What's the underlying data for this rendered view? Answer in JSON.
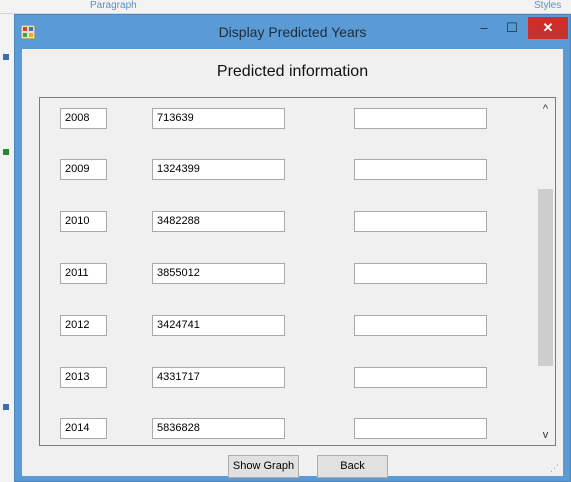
{
  "background": {
    "ribbon_tabs": [
      "Paragraph",
      "Styles"
    ]
  },
  "window": {
    "title": "Display Predicted Years",
    "controls": {
      "minimize": "–",
      "maximize": "☐",
      "close": "✕"
    },
    "heading": "Predicted information"
  },
  "rows": [
    {
      "year": "2008",
      "value": "713639",
      "extra": ""
    },
    {
      "year": "2009",
      "value": "1324399",
      "extra": ""
    },
    {
      "year": "2010",
      "value": "3482288",
      "extra": ""
    },
    {
      "year": "2011",
      "value": "3855012",
      "extra": ""
    },
    {
      "year": "2012",
      "value": "3424741",
      "extra": ""
    },
    {
      "year": "2013",
      "value": "4331717",
      "extra": ""
    },
    {
      "year": "2014",
      "value": "5836828",
      "extra": ""
    }
  ],
  "scrollbar": {
    "up_arrow": "^",
    "down_arrow": "v"
  },
  "buttons": {
    "show_graph": "Show Graph",
    "back": "Back"
  },
  "colors": {
    "titlebar": "#5b9bd5",
    "close": "#c9302c",
    "client": "#f0f0f0"
  }
}
